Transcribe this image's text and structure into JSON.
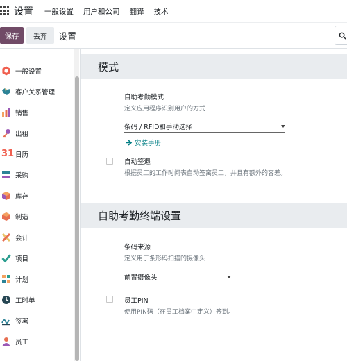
{
  "topbar": {
    "app_name": "设置",
    "menu": [
      "一般设置",
      "用户和公司",
      "翻译",
      "技术"
    ]
  },
  "control": {
    "save_label": "保存",
    "discard_label": "丢弃",
    "breadcrumb": "设置",
    "search_icon": "search-icon"
  },
  "sidebar": {
    "items": [
      {
        "label": "一般设置",
        "icon": "general-settings-icon",
        "color": "#f06050"
      },
      {
        "label": "客户关系管理",
        "icon": "crm-icon",
        "color": "#2c8397"
      },
      {
        "label": "销售",
        "icon": "sales-icon",
        "color": "#f4a261"
      },
      {
        "label": "出租",
        "icon": "rental-icon",
        "color": "#9b59b6"
      },
      {
        "label": "日历",
        "icon": "calendar-icon",
        "color": "#f06050"
      },
      {
        "label": "采购",
        "icon": "purchase-icon",
        "color": "#2c8397"
      },
      {
        "label": "库存",
        "icon": "inventory-icon",
        "color": "#f4a261"
      },
      {
        "label": "制造",
        "icon": "manufacturing-icon",
        "color": "#e76f51"
      },
      {
        "label": "会计",
        "icon": "accounting-icon",
        "color": "#e9c46a"
      },
      {
        "label": "项目",
        "icon": "project-icon",
        "color": "#2a9d8f"
      },
      {
        "label": "计划",
        "icon": "planning-icon",
        "color": "#f4a261"
      },
      {
        "label": "工时单",
        "icon": "timesheet-icon",
        "color": "#264653"
      },
      {
        "label": "签署",
        "icon": "sign-icon",
        "color": "#2c8397"
      },
      {
        "label": "员工",
        "icon": "employees-icon",
        "color": "#e76f51"
      }
    ]
  },
  "main": {
    "section1": {
      "title": "模式",
      "kiosk_mode_label": "自助考勤模式",
      "kiosk_mode_desc": "定义应用程序识别用户的方式",
      "kiosk_mode_value": "条码 / RFID和手动选择",
      "install_link": "安装手册",
      "auto_checkout_label": "自动签退",
      "auto_checkout_desc": "根据员工的工作时间表自动签离员工，并且有额外的容差。"
    },
    "section2": {
      "title": "自助考勤终端设置",
      "barcode_source_label": "条码来源",
      "barcode_source_desc": "定义用于条形码扫描的摄像头",
      "barcode_source_value": "前置摄像头",
      "pin_label": "员工PIN",
      "pin_desc": "使用PIN码（在员工档案中定义）签到。"
    }
  }
}
